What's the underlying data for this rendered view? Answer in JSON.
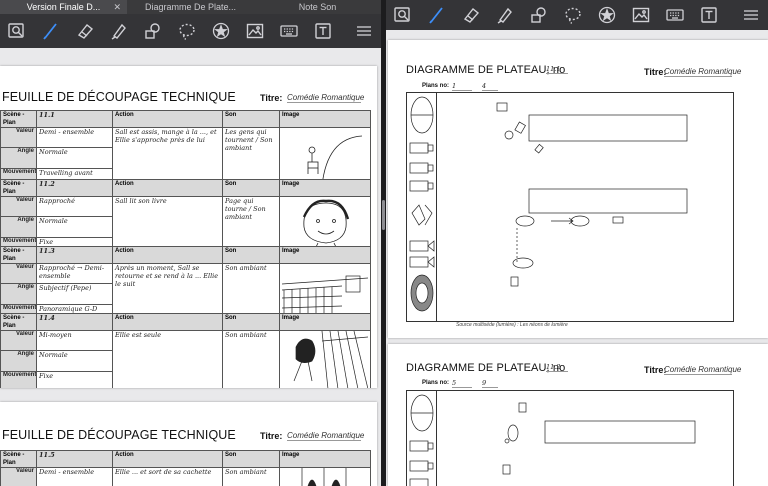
{
  "tabs": [
    {
      "label": "Version Finale D...",
      "active": true
    },
    {
      "label": "Diagramme De Plate..."
    },
    {
      "label": "Note Son"
    }
  ],
  "toolbar": {
    "tools": [
      {
        "icon": "zoom-page-icon"
      },
      {
        "icon": "pen-icon",
        "active": true
      },
      {
        "icon": "eraser-icon"
      },
      {
        "icon": "highlighter-icon"
      },
      {
        "icon": "shapes-icon"
      },
      {
        "icon": "lasso-icon"
      },
      {
        "icon": "star-stamp-icon"
      },
      {
        "icon": "image-icon"
      },
      {
        "icon": "keyboard-icon"
      },
      {
        "icon": "text-box-icon"
      },
      {
        "icon": "menu-icon"
      }
    ]
  },
  "left_doc": {
    "page1": {
      "title": "FEUILLE DE DÉCOUPAGE TECHNIQUE",
      "titre_label": "Titre:",
      "titre_value": "Comédie Romantique",
      "headers": {
        "scene": "Scène - Plan",
        "action": "Action",
        "son": "Son",
        "image": "Image"
      },
      "labels": {
        "valeur": "Valeur",
        "angle": "Angle",
        "mouvement": "Mouvement"
      },
      "scenes": [
        {
          "plan": "11.1",
          "valeur": "Demi - ensemble",
          "angle": "Normale",
          "mouvement": "Travelling avant",
          "action": "Sall est assis, mange à la ..., et Ellie s'approche près de lui",
          "son": "Les gens qui tournent / Son ambiant"
        },
        {
          "plan": "11.2",
          "valeur": "Rapproché",
          "angle": "Normale",
          "mouvement": "Fixe",
          "action": "Sall lit son livre",
          "son": "Page qui tourne / Son ambiant"
        },
        {
          "plan": "11.3",
          "valeur": "Rapproché → Demi-ensemble",
          "angle": "Subjectif (Pepe)",
          "mouvement": "Panoramique G-D",
          "action": "Après un moment, Sall se retourne et se rend à la ... Ellie le suit",
          "son": "Son ambiant"
        },
        {
          "plan": "11.4",
          "valeur": "Mi-moyen",
          "angle": "Normale",
          "mouvement": "Fixe",
          "action": "Ellie est seule",
          "son": "Son ambiant"
        }
      ]
    },
    "page2": {
      "title": "FEUILLE DE DÉCOUPAGE TECHNIQUE",
      "titre_label": "Titre:",
      "titre_value": "Comédie Romantique",
      "scene": {
        "plan": "11.5",
        "valeur": "Demi - ensemble",
        "action": "Ellie ... et sort de sa cachette",
        "son": "Son ambiant"
      }
    }
  },
  "right_doc": {
    "page1": {
      "title": "DIAGRAMME DE PLATEAU, no",
      "title_no": "11.1",
      "titre_label": "Titre:",
      "titre_value": "Comédie Romantique",
      "plans_label": "Plans no:",
      "plans_from": "1",
      "plans_to": "4",
      "note": "Source multiséde (lumière) : Les néons de lumière"
    },
    "page2": {
      "title": "DIAGRAMME DE PLATEAU, no",
      "title_no": "11.2",
      "titre_label": "Titre:",
      "titre_value": "Comédie Romantique",
      "plans_label": "Plans no:",
      "plans_from": "5",
      "plans_to": "9"
    }
  }
}
